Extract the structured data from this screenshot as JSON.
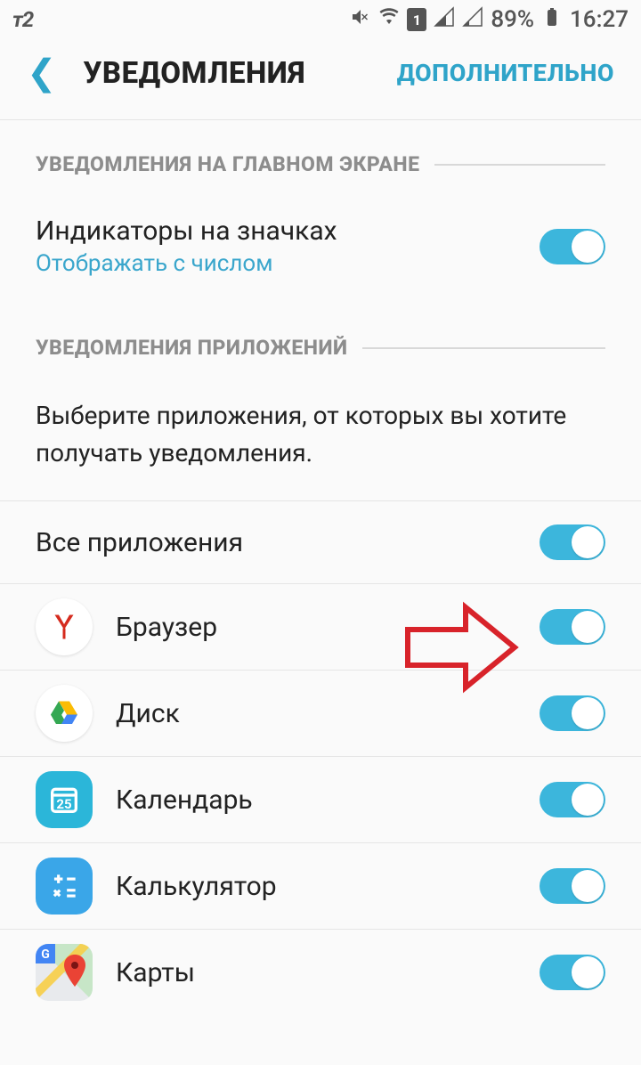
{
  "status": {
    "carrier": "т2",
    "battery": "89%",
    "time": "16:27",
    "sim": "1"
  },
  "header": {
    "title": "УВЕДОМЛЕНИЯ",
    "action": "ДОПОЛНИТЕЛЬНО"
  },
  "section1": {
    "label": "УВЕДОМЛЕНИЯ НА ГЛАВНОМ ЭКРАНЕ"
  },
  "badge": {
    "title": "Индикаторы на значках",
    "sub": "Отображать с числом"
  },
  "section2": {
    "label": "УВЕДОМЛЕНИЯ ПРИЛОЖЕНИЙ"
  },
  "desc": "Выберите приложения, от которых вы хотите получать уведомления.",
  "allApps": {
    "label": "Все приложения"
  },
  "apps": [
    {
      "name": "Браузер"
    },
    {
      "name": "Диск"
    },
    {
      "name": "Календарь"
    },
    {
      "name": "Калькулятор"
    },
    {
      "name": "Карты"
    }
  ]
}
